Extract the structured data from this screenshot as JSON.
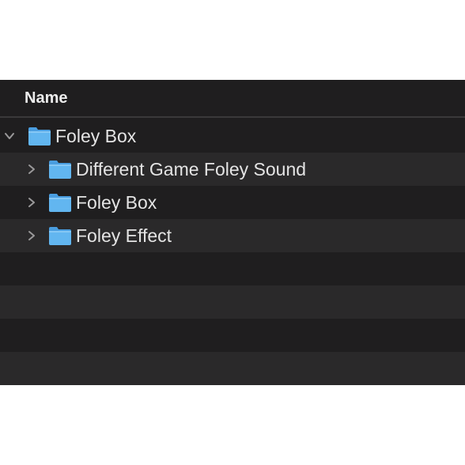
{
  "header": {
    "name_column": "Name"
  },
  "rows": [
    {
      "label": "Foley Box",
      "expanded": true,
      "level": 0,
      "icon": "folder-icon"
    },
    {
      "label": "Different Game Foley Sound",
      "expanded": false,
      "level": 1,
      "icon": "folder-icon"
    },
    {
      "label": "Foley Box",
      "expanded": false,
      "level": 1,
      "icon": "folder-icon"
    },
    {
      "label": "Foley Effect",
      "expanded": false,
      "level": 1,
      "icon": "folder-icon"
    }
  ],
  "colors": {
    "background": "#1f1e1f",
    "row_alternate": "#2a292a",
    "text": "#e4e4e4",
    "folder_blue": "#5fb3ee"
  }
}
